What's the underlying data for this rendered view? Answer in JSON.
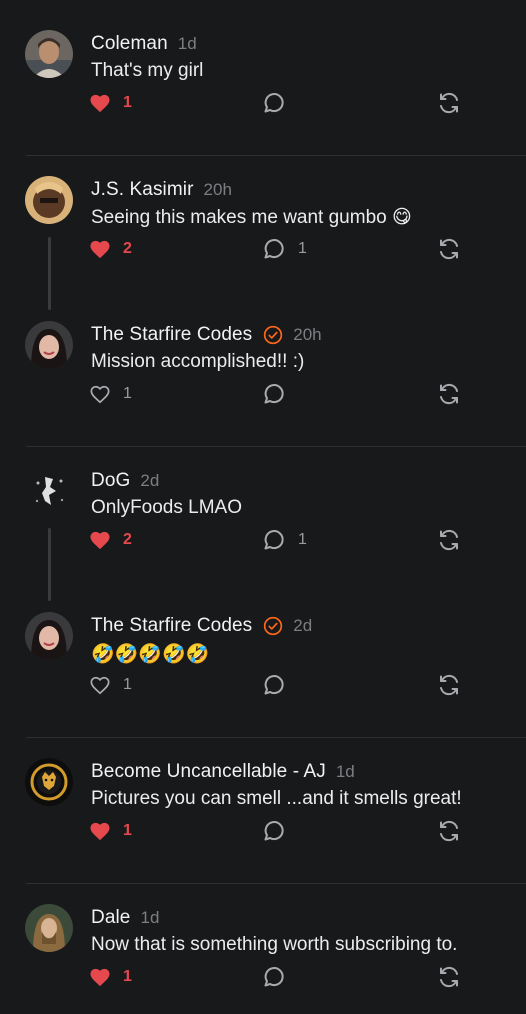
{
  "colors": {
    "background": "#18191b",
    "liked": "#e5484d",
    "muted": "#9a9b9f",
    "verified": "#ff6719"
  },
  "comments": [
    {
      "author": "Coleman",
      "time": "1d",
      "text": "That's my girl",
      "likes": "1",
      "liked": true,
      "replies": "",
      "verified": false
    },
    {
      "author": "J.S. Kasimir",
      "time": "20h",
      "text": "Seeing this makes me want gumbo 😋",
      "likes": "2",
      "liked": true,
      "replies": "1",
      "verified": false
    },
    {
      "author": "The Starfire Codes",
      "time": "20h",
      "text": "Mission accomplished!! :)",
      "likes": "1",
      "liked": false,
      "replies": "",
      "verified": true
    },
    {
      "author": "DoG",
      "time": "2d",
      "text": "OnlyFoods LMAO",
      "likes": "2",
      "liked": true,
      "replies": "1",
      "verified": false
    },
    {
      "author": "The Starfire Codes",
      "time": "2d",
      "text": "🤣🤣🤣🤣🤣",
      "likes": "1",
      "liked": false,
      "replies": "",
      "verified": true
    },
    {
      "author": "Become Uncancellable - AJ",
      "time": "1d",
      "text": "Pictures you can smell ...and it smells great!",
      "likes": "1",
      "liked": true,
      "replies": "",
      "verified": false
    },
    {
      "author": "Dale",
      "time": "1d",
      "text": "Now that is something worth subscribing to.",
      "likes": "1",
      "liked": true,
      "replies": "",
      "verified": false
    }
  ]
}
